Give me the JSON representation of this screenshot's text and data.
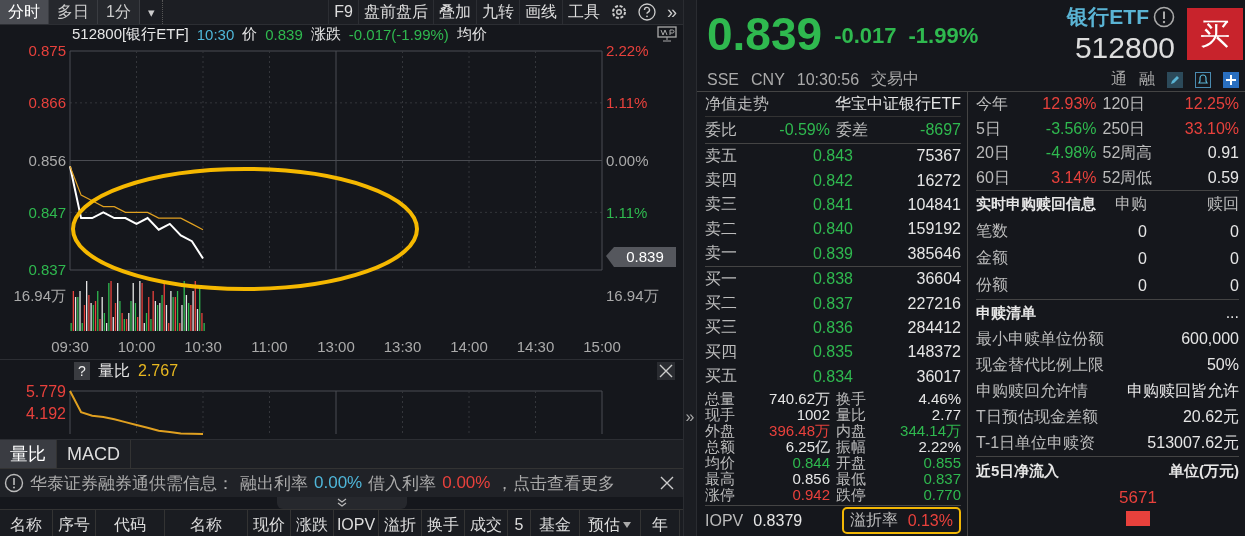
{
  "toolbar": {
    "tabs": [
      {
        "label": "分时",
        "selected": true
      },
      {
        "label": "多日",
        "selected": false
      },
      {
        "label": "1分",
        "selected": false
      }
    ],
    "dropdown": "▾",
    "tools": [
      "F9",
      "盘前盘后",
      "叠加",
      "九转",
      "画线",
      "工具"
    ],
    "more": "»"
  },
  "chart_header": {
    "symbol": "512800[银行ETF]",
    "time": "10:30",
    "price_label": "价",
    "price": "0.839",
    "change_label": "涨跌",
    "change": "-0.017(-1.99%)",
    "avg_label": "均价"
  },
  "main_chart": {
    "chart_data": {
      "type": "line",
      "categories": [
        "09:30",
        null,
        null,
        null,
        null,
        null,
        "10:00",
        null,
        null,
        null,
        null,
        null,
        "10:30",
        null,
        null,
        null,
        null,
        null,
        "11:00",
        null,
        null,
        null,
        null,
        null,
        "13:00",
        null,
        null,
        null,
        null,
        null,
        "13:30",
        null,
        null,
        null,
        null,
        null,
        "14:00",
        null,
        null,
        null,
        null,
        null,
        "14:30",
        null,
        null,
        null,
        null,
        null,
        "15:00"
      ],
      "series": [
        {
          "color": "#ffffff",
          "values": [
            0.855,
            0.846,
            0.846,
            0.847,
            0.846,
            0.846,
            0.845,
            0.846,
            0.844,
            0.845,
            0.843,
            0.842,
            0.839,
            null,
            null,
            null,
            null,
            null,
            null,
            null,
            null,
            null,
            null,
            null,
            null,
            null,
            null,
            null,
            null,
            null,
            null,
            null,
            null,
            null,
            null,
            null,
            null,
            null,
            null,
            null,
            null,
            null,
            null,
            null,
            null,
            null,
            null,
            null,
            null
          ]
        },
        {
          "color": "#e0a020",
          "values": [
            0.855,
            0.85,
            0.849,
            0.848,
            0.848,
            0.847,
            0.847,
            0.847,
            0.846,
            0.846,
            0.846,
            0.845,
            0.844,
            null,
            null,
            null,
            null,
            null,
            null,
            null,
            null,
            null,
            null,
            null,
            null,
            null,
            null,
            null,
            null,
            null,
            null,
            null,
            null,
            null,
            null,
            null,
            null,
            null,
            null,
            null,
            null,
            null,
            null,
            null,
            null,
            null,
            null,
            null,
            null
          ]
        }
      ],
      "ylim": [
        0.837,
        0.875
      ],
      "grid": true,
      "yticks": [
        {
          "value": 0.875,
          "label": "0.875"
        },
        {
          "value": 0.866,
          "label": "0.866"
        },
        {
          "value": 0.856,
          "label": "0.856"
        },
        {
          "value": 0.847,
          "label": "0.847"
        },
        {
          "value": 0.837,
          "label": "0.837"
        }
      ]
    },
    "right_labels": [
      {
        "label": "2.22%",
        "color": "#e8413c"
      },
      {
        "label": "1.11%",
        "color": "#e8413c"
      },
      {
        "label": "0.00%",
        "color": "#aaaaaa"
      },
      {
        "label": "1.11%",
        "color": "#2fb94f"
      }
    ],
    "left_volume_label": "16.94万",
    "right_volume_label": "16.94万",
    "price_tag": "0.839"
  },
  "ratio_chart": {
    "help": "?",
    "title": "量比",
    "value": "2.767",
    "chart_data": {
      "type": "line",
      "categories": [
        null,
        null,
        null,
        null,
        null,
        null,
        null,
        null,
        null,
        null,
        null,
        null,
        null,
        null,
        null,
        null,
        null,
        null,
        null,
        null,
        null,
        null,
        null,
        null,
        null,
        null,
        null,
        null,
        null,
        null,
        null,
        null,
        null,
        null,
        null,
        null,
        null,
        null,
        null,
        null,
        null,
        null,
        null,
        null,
        null,
        null,
        null,
        null,
        null
      ],
      "series": [
        {
          "color": "#e0a020",
          "values": [
            5.779,
            4.3,
            4.05,
            3.95,
            3.8,
            3.6,
            3.4,
            3.2,
            3.0,
            2.9,
            2.8,
            2.78,
            2.77,
            null,
            null,
            null,
            null,
            null,
            null,
            null,
            null,
            null,
            null,
            null,
            null,
            null,
            null,
            null,
            null,
            null,
            null,
            null,
            null,
            null,
            null,
            null,
            null,
            null,
            null,
            null,
            null,
            null,
            null,
            null,
            null,
            null,
            null,
            null,
            null
          ]
        }
      ],
      "ylim": [
        2.767,
        5.779
      ],
      "grid": true,
      "yticks": [
        {
          "value": 5.779,
          "label": "5.779"
        },
        {
          "value": 4.192,
          "label": "4.192"
        }
      ]
    }
  },
  "indicator_tabs": [
    {
      "label": "量比",
      "selected": true
    },
    {
      "label": "MACD",
      "selected": false
    }
  ],
  "info_bar": {
    "source": "华泰证券融券通供需信息：",
    "lend_label": "融出利率",
    "lend_rate": "0.00%",
    "borrow_label": "借入利率",
    "borrow_rate": "0.00%",
    "more": "，点击查看更多"
  },
  "table_header": [
    {
      "label": "名称",
      "has_menu": false
    },
    {
      "label": "序号",
      "has_menu": false
    },
    {
      "label": "代码",
      "has_menu": false
    },
    {
      "label": "名称",
      "has_menu": false
    },
    {
      "label": "现价",
      "has_menu": false
    },
    {
      "label": "涨跌",
      "has_menu": false
    },
    {
      "label": "IOPV",
      "has_menu": false
    },
    {
      "label": "溢折",
      "has_menu": false
    },
    {
      "label": "换手",
      "has_menu": false
    },
    {
      "label": "成交",
      "has_menu": false
    },
    {
      "label": "5",
      "has_menu": false
    },
    {
      "label": "基金",
      "has_menu": false
    },
    {
      "label": "预估",
      "has_menu": true
    },
    {
      "label": "年",
      "has_menu": false
    }
  ],
  "sidebar_toggle": "»",
  "quote": {
    "price": "0.839",
    "change": "-0.017",
    "change_pct": "-1.99%",
    "name": "银行ETF",
    "code": "512800",
    "buy": "买"
  },
  "status": {
    "exchange": "SSE",
    "currency": "CNY",
    "time": "10:30:56",
    "state": "交易中",
    "tags": [
      "通",
      "融"
    ]
  },
  "nav": {
    "label": "净值走势",
    "fund": "华宝中证银行ETF"
  },
  "commission": {
    "ratio_label": "委比",
    "ratio": "-0.59%",
    "diff_label": "委差",
    "diff": "-8697"
  },
  "asks": [
    {
      "label": "卖五",
      "price": "0.843",
      "volume": "75367"
    },
    {
      "label": "卖四",
      "price": "0.842",
      "volume": "16272"
    },
    {
      "label": "卖三",
      "price": "0.841",
      "volume": "104841"
    },
    {
      "label": "卖二",
      "price": "0.840",
      "volume": "159192"
    },
    {
      "label": "卖一",
      "price": "0.839",
      "volume": "385646"
    }
  ],
  "bids": [
    {
      "label": "买一",
      "price": "0.838",
      "volume": "36604"
    },
    {
      "label": "买二",
      "price": "0.837",
      "volume": "227216"
    },
    {
      "label": "买三",
      "price": "0.836",
      "volume": "284412"
    },
    {
      "label": "买四",
      "price": "0.835",
      "volume": "148372"
    },
    {
      "label": "买五",
      "price": "0.834",
      "volume": "36017"
    }
  ],
  "stats": [
    {
      "label": "总量",
      "value": "740.62万",
      "color": "#e6e6e6"
    },
    {
      "label": "换手",
      "value": "4.46%",
      "color": "#e6e6e6"
    },
    {
      "label": "现手",
      "value": "1002",
      "color": "#e6e6e6"
    },
    {
      "label": "量比",
      "value": "2.77",
      "color": "#e6e6e6"
    },
    {
      "label": "外盘",
      "value": "396.48万",
      "color": "#e8413c"
    },
    {
      "label": "内盘",
      "value": "344.14万",
      "color": "#2fb94f"
    },
    {
      "label": "总额",
      "value": "6.25亿",
      "color": "#e6e6e6"
    },
    {
      "label": "振幅",
      "value": "2.22%",
      "color": "#e6e6e6"
    },
    {
      "label": "均价",
      "value": "0.844",
      "color": "#2fb94f"
    },
    {
      "label": "开盘",
      "value": "0.855",
      "color": "#2fb94f"
    },
    {
      "label": "最高",
      "value": "0.856",
      "color": "#e6e6e6"
    },
    {
      "label": "最低",
      "value": "0.837",
      "color": "#2fb94f"
    },
    {
      "label": "涨停",
      "value": "0.942",
      "color": "#e8413c"
    },
    {
      "label": "跌停",
      "value": "0.770",
      "color": "#2fb94f"
    }
  ],
  "iopv": {
    "label": "IOPV",
    "value": "0.8379"
  },
  "premium": {
    "label": "溢折率",
    "value": "0.13%"
  },
  "returns": [
    {
      "label": "今年",
      "value": "12.93%",
      "color": "#e8413c"
    },
    {
      "label": "120日",
      "value": "12.25%",
      "color": "#e8413c"
    },
    {
      "label": "5日",
      "value": "-3.56%",
      "color": "#2fb94f"
    },
    {
      "label": "250日",
      "value": "33.10%",
      "color": "#e8413c"
    },
    {
      "label": "20日",
      "value": "-4.98%",
      "color": "#2fb94f"
    },
    {
      "label": "52周高",
      "value": "0.91",
      "color": "#e6e6e6"
    },
    {
      "label": "60日",
      "value": "3.14%",
      "color": "#e8413c"
    },
    {
      "label": "52周低",
      "value": "0.59",
      "color": "#e6e6e6"
    }
  ],
  "creation": {
    "title": "实时申购赎回信息",
    "columns": [
      "申购",
      "赎回"
    ],
    "rows": [
      {
        "label": "笔数",
        "values": [
          "0",
          "0"
        ]
      },
      {
        "label": "金额",
        "values": [
          "0",
          "0"
        ]
      },
      {
        "label": "份额",
        "values": [
          "0",
          "0"
        ]
      }
    ]
  },
  "basket": {
    "title": "申赎清单",
    "more": "...",
    "rows": [
      {
        "label": "最小申赎单位份额",
        "value": "600,000"
      },
      {
        "label": "现金替代比例上限",
        "value": "50%"
      },
      {
        "label": "申购赎回允许情",
        "value": "申购赎回皆允许"
      },
      {
        "label": "T日预估现金差额",
        "value": "20.62元"
      },
      {
        "label": "T-1日单位申赎资",
        "value": "513007.62元"
      }
    ]
  },
  "net_inflow": {
    "title": "近5日净流入",
    "unit": "单位(万元)",
    "value": "5671"
  }
}
